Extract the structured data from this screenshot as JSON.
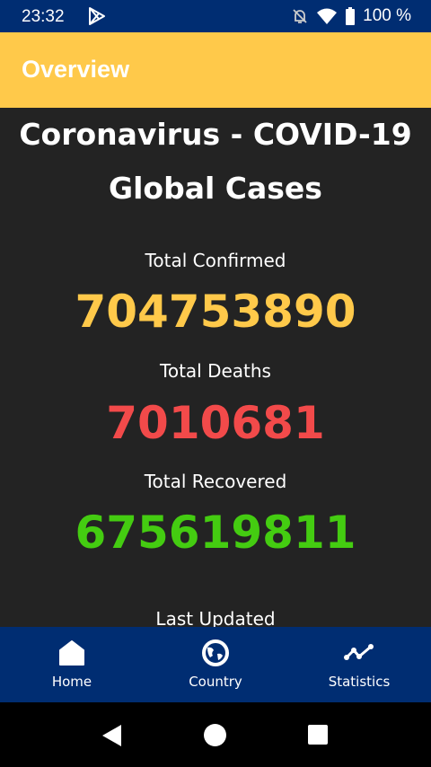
{
  "status_bar": {
    "time": "23:32",
    "battery": "100 %"
  },
  "app_bar": {
    "title": "Overview"
  },
  "main": {
    "heading_line1": "Coronavirus - COVID-19",
    "heading_line2": "Global Cases",
    "confirmed_label": "Total Confirmed",
    "confirmed_value": "704753890",
    "deaths_label": "Total Deaths",
    "deaths_value": "7010681",
    "recovered_label": "Total Recovered",
    "recovered_value": "675619811",
    "last_updated_label": "Last Updated"
  },
  "colors": {
    "confirmed": "#ffc94a",
    "deaths": "#f24a4a",
    "recovered": "#44cc11",
    "primary": "#002d72"
  },
  "bottom_nav": {
    "items": [
      {
        "label": "Home",
        "icon": "home-icon"
      },
      {
        "label": "Country",
        "icon": "globe-icon"
      },
      {
        "label": "Statistics",
        "icon": "chart-line-icon"
      }
    ]
  }
}
